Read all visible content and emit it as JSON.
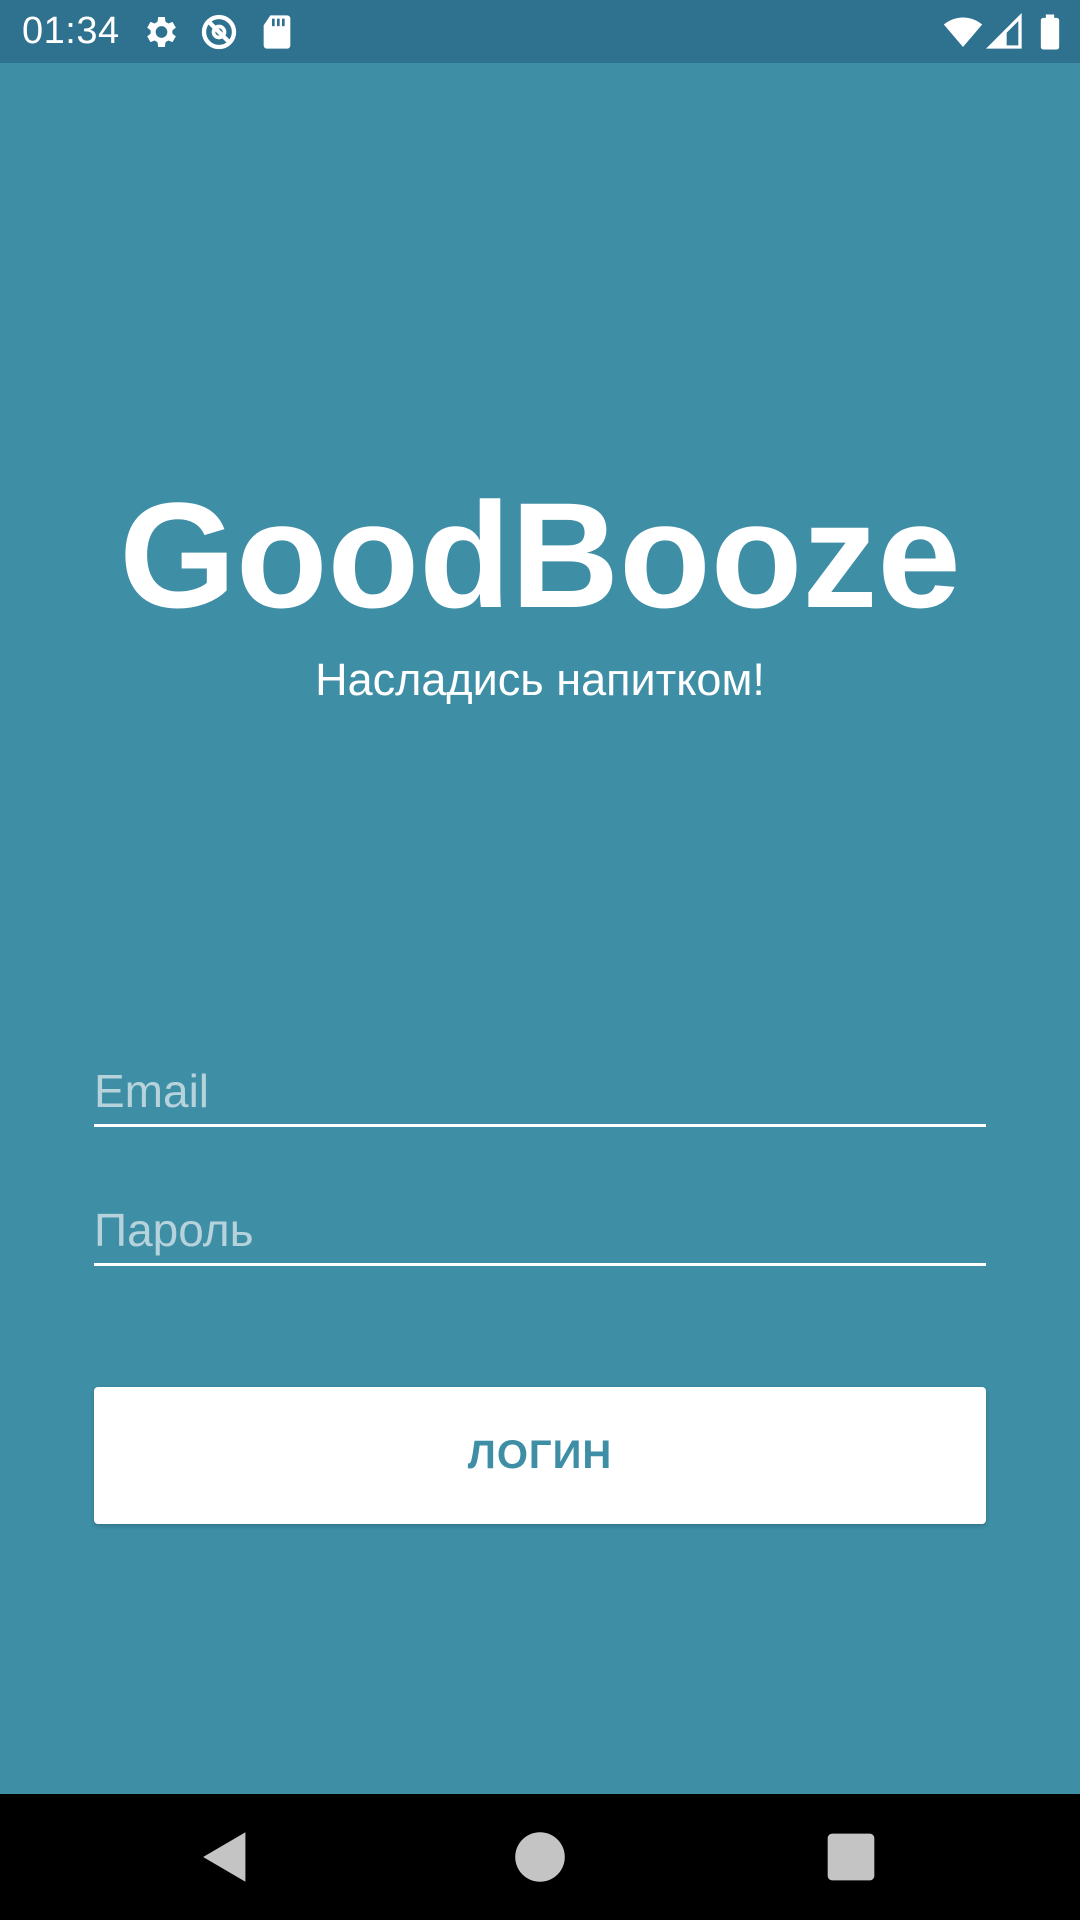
{
  "status_bar": {
    "time": "01:34",
    "icons": [
      "settings-icon",
      "do-not-disturb-icon",
      "sd-card-icon",
      "wifi-icon",
      "signal-icon",
      "battery-icon"
    ],
    "background": "#2f7290"
  },
  "app": {
    "title": "GoodBooze",
    "subtitle": "Насладись напитком!",
    "background": "#3e8ea6"
  },
  "form": {
    "email": {
      "placeholder": "Email",
      "value": ""
    },
    "password": {
      "placeholder": "Пароль",
      "value": ""
    },
    "login_label": "ЛОГИН"
  },
  "nav_bar": {
    "icons": [
      "back-icon",
      "home-icon",
      "recents-icon"
    ]
  }
}
